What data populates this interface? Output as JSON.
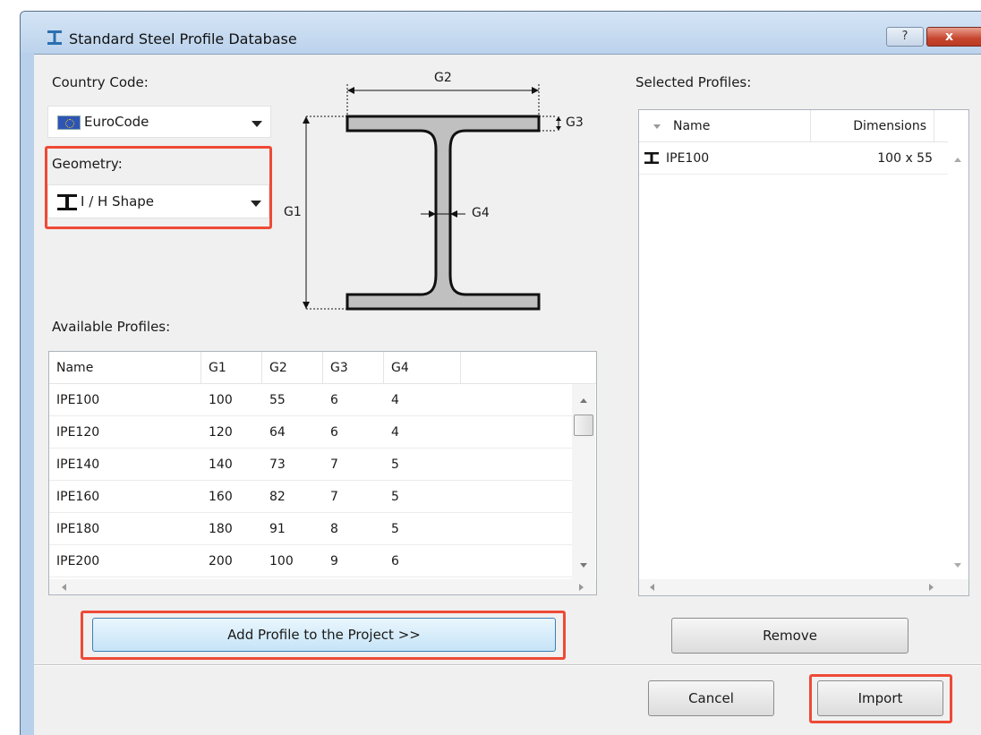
{
  "window": {
    "title": "Standard Steel Profile Database",
    "help_label": "?",
    "close_label": "x"
  },
  "country": {
    "label": "Country Code:",
    "value": "EuroCode"
  },
  "geometry": {
    "label": "Geometry:",
    "value": "I / H Shape"
  },
  "diagram": {
    "g1": "G1",
    "g2": "G2",
    "g3": "G3",
    "g4": "G4"
  },
  "available": {
    "label": "Available Profiles:",
    "columns": [
      "Name",
      "G1",
      "G2",
      "G3",
      "G4"
    ],
    "rows": [
      [
        "IPE100",
        "100",
        "55",
        "6",
        "4"
      ],
      [
        "IPE120",
        "120",
        "64",
        "6",
        "4"
      ],
      [
        "IPE140",
        "140",
        "73",
        "7",
        "5"
      ],
      [
        "IPE160",
        "160",
        "82",
        "7",
        "5"
      ],
      [
        "IPE180",
        "180",
        "91",
        "8",
        "5"
      ],
      [
        "IPE200",
        "200",
        "100",
        "9",
        "6"
      ]
    ]
  },
  "selected": {
    "label": "Selected Profiles:",
    "columns": [
      "Name",
      "Dimensions"
    ],
    "rows": [
      [
        "IPE100",
        "100 x 55"
      ]
    ]
  },
  "buttons": {
    "add": "Add Profile to the Project >>",
    "remove": "Remove",
    "cancel": "Cancel",
    "import": "Import"
  },
  "colors": {
    "highlight": "#ee4a36",
    "profile_fill": "#c0c0c0",
    "title_bar": "#bcd3ec"
  }
}
